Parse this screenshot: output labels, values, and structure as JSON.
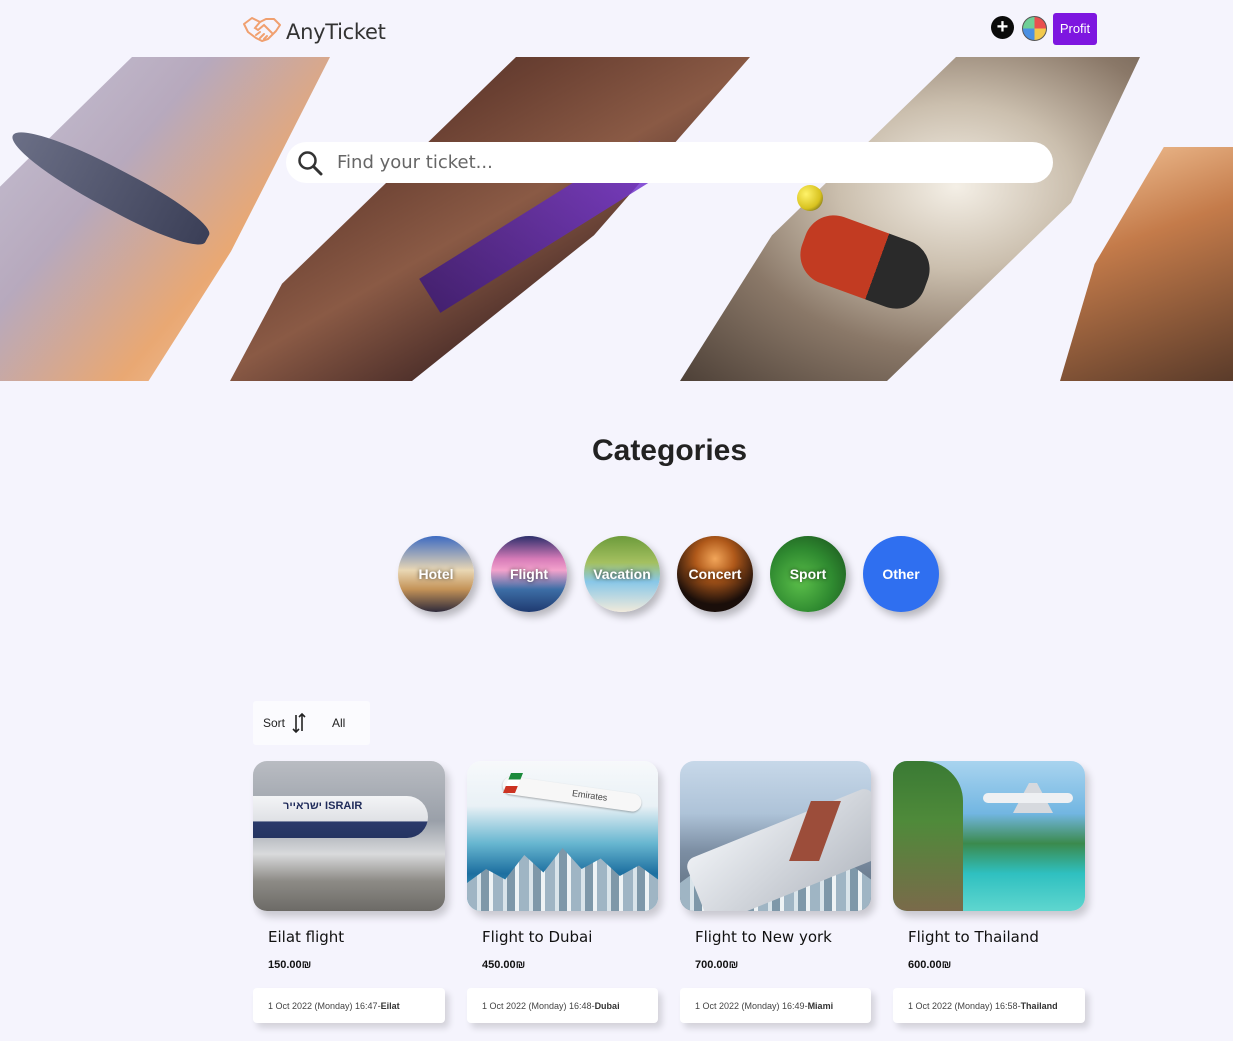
{
  "header": {
    "brand": "AnyTicket",
    "logo_icon": "handshake-icon",
    "add_icon": "+",
    "profit_label": "Profit"
  },
  "search": {
    "placeholder": "Find your ticket..."
  },
  "categories": {
    "title": "Categories",
    "items": [
      {
        "label": "Hotel"
      },
      {
        "label": "Flight"
      },
      {
        "label": "Vacation"
      },
      {
        "label": "Concert"
      },
      {
        "label": "Sport"
      },
      {
        "label": "Other"
      }
    ]
  },
  "sortbar": {
    "sort_label": "Sort",
    "filter_label": "All"
  },
  "tickets": [
    {
      "title": "Eilat flight",
      "price": "150.00₪",
      "date": "1 Oct 2022 (Monday) 16:47- ",
      "location": "Eilat",
      "image_text": "ישראייר ISRAIR"
    },
    {
      "title": "Flight to Dubai",
      "price": "450.00₪",
      "date": "1 Oct 2022 (Monday) 16:48- ",
      "location": "Dubai",
      "image_text": "Emirates"
    },
    {
      "title": "Flight to New york",
      "price": "700.00₪",
      "date": "1 Oct 2022 (Monday) 16:49- ",
      "location": "Miami"
    },
    {
      "title": "Flight to Thailand",
      "price": "600.00₪",
      "date": "1 Oct 2022 (Monday) 16:58- ",
      "location": "Thailand"
    }
  ],
  "colors": {
    "background": "#f5f4fd",
    "profit_button": "#7e16e0",
    "other_category": "#2f6ff0",
    "logo_accent": "#f0a070"
  }
}
